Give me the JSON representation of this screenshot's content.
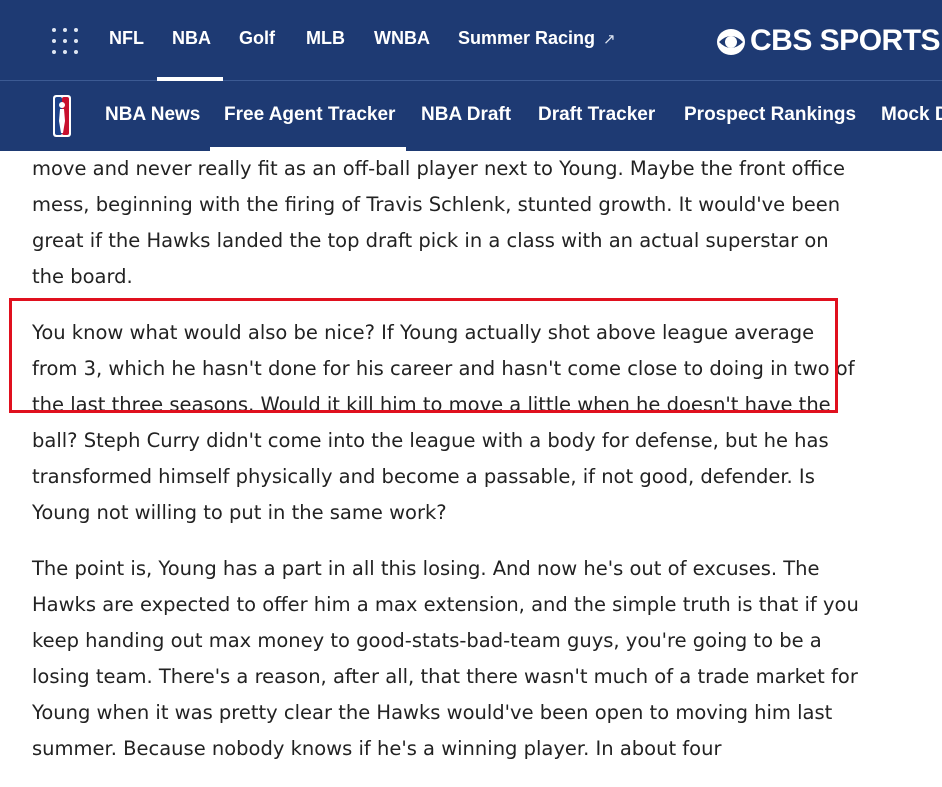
{
  "top_nav": {
    "items": [
      "NFL",
      "NBA",
      "Golf",
      "MLB",
      "WNBA",
      "Summer Racing"
    ],
    "external_arrow": "↗",
    "active": "NBA",
    "brand": "CBS SPORTS"
  },
  "sub_nav": {
    "items": [
      "NBA News",
      "Free Agent Tracker",
      "NBA Draft",
      "Draft Tracker",
      "Prospect Rankings",
      "Mock D"
    ],
    "active": "Free Agent Tracker"
  },
  "article": {
    "paragraphs": [
      "move and never really fit as an off-ball player next to Young. Maybe the front office mess, beginning with the firing of Travis Schlenk, stunted growth. It would've been great if the Hawks landed the top draft pick in a class with an actual superstar on the board.",
      "You know what would also be nice? If Young actually shot above league average from 3, which he hasn't done for his career and hasn't come close to doing in two of the last three seasons. Would it kill him to move a little when he doesn't have the ball? Steph Curry didn't come into the league with a body for defense, but he has transformed himself physically and become a passable, if not good, defender. Is Young not willing to put in the same work?",
      "The point is, Young has a part in all this losing. And now he's out of excuses. The Hawks are expected to offer him a max extension, and the simple truth is that if you keep handing out max money to good-stats-bad-team guys, you're going to be a losing team. There's a reason, after all, that there wasn't much of a trade market for Young when it was pretty clear the Hawks would've been open to moving him last summer. Because nobody knows if he's a winning player. In about four"
    ]
  },
  "colors": {
    "nav_bg": "#1e3a73",
    "text": "#222222",
    "highlight": "#e0101e"
  }
}
